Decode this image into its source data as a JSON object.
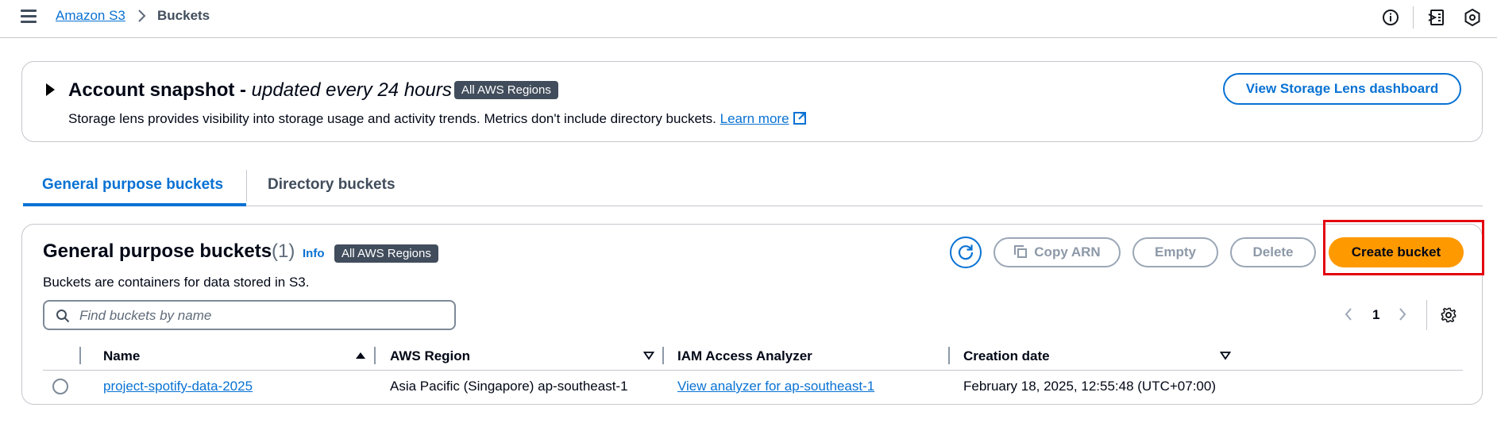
{
  "breadcrumb": {
    "root": "Amazon S3",
    "current": "Buckets"
  },
  "snapshot": {
    "title": "Account snapshot",
    "title_sep": " - ",
    "subtitle": "updated every 24 hours",
    "badge": "All AWS Regions",
    "description": "Storage lens provides visibility into storage usage and activity trends. Metrics don't include directory buckets.",
    "learn_more": "Learn more",
    "button": "View Storage Lens dashboard"
  },
  "tabs": [
    {
      "label": "General purpose buckets",
      "active": true
    },
    {
      "label": "Directory buckets",
      "active": false
    }
  ],
  "buckets_panel": {
    "title": "General purpose buckets",
    "count": "(1)",
    "info": "Info",
    "badge": "All AWS Regions",
    "description": "Buckets are containers for data stored in S3.",
    "actions": {
      "copy_arn": "Copy ARN",
      "empty": "Empty",
      "delete": "Delete",
      "create": "Create bucket"
    },
    "search_placeholder": "Find buckets by name",
    "page": "1"
  },
  "table": {
    "columns": [
      "Name",
      "AWS Region",
      "IAM Access Analyzer",
      "Creation date"
    ],
    "rows": [
      {
        "name": "project-spotify-data-2025",
        "region": "Asia Pacific (Singapore) ap-southeast-1",
        "analyzer": "View analyzer for ap-southeast-1",
        "created": "February 18, 2025, 12:55:48 (UTC+07:00)"
      }
    ]
  },
  "colors": {
    "link": "#0972d3",
    "primary_button": "#ff9900",
    "highlight": "#e3000f",
    "badge_bg": "#414d5c"
  },
  "icons": [
    "menu-icon",
    "chevron-right-icon",
    "info-circle-icon",
    "notifications-icon",
    "settings-hex-icon",
    "caret-right-icon",
    "external-link-icon",
    "refresh-icon",
    "copy-icon",
    "search-icon",
    "chevron-left-icon",
    "gear-icon",
    "sort-ascending-icon",
    "sort-descending-icon"
  ]
}
